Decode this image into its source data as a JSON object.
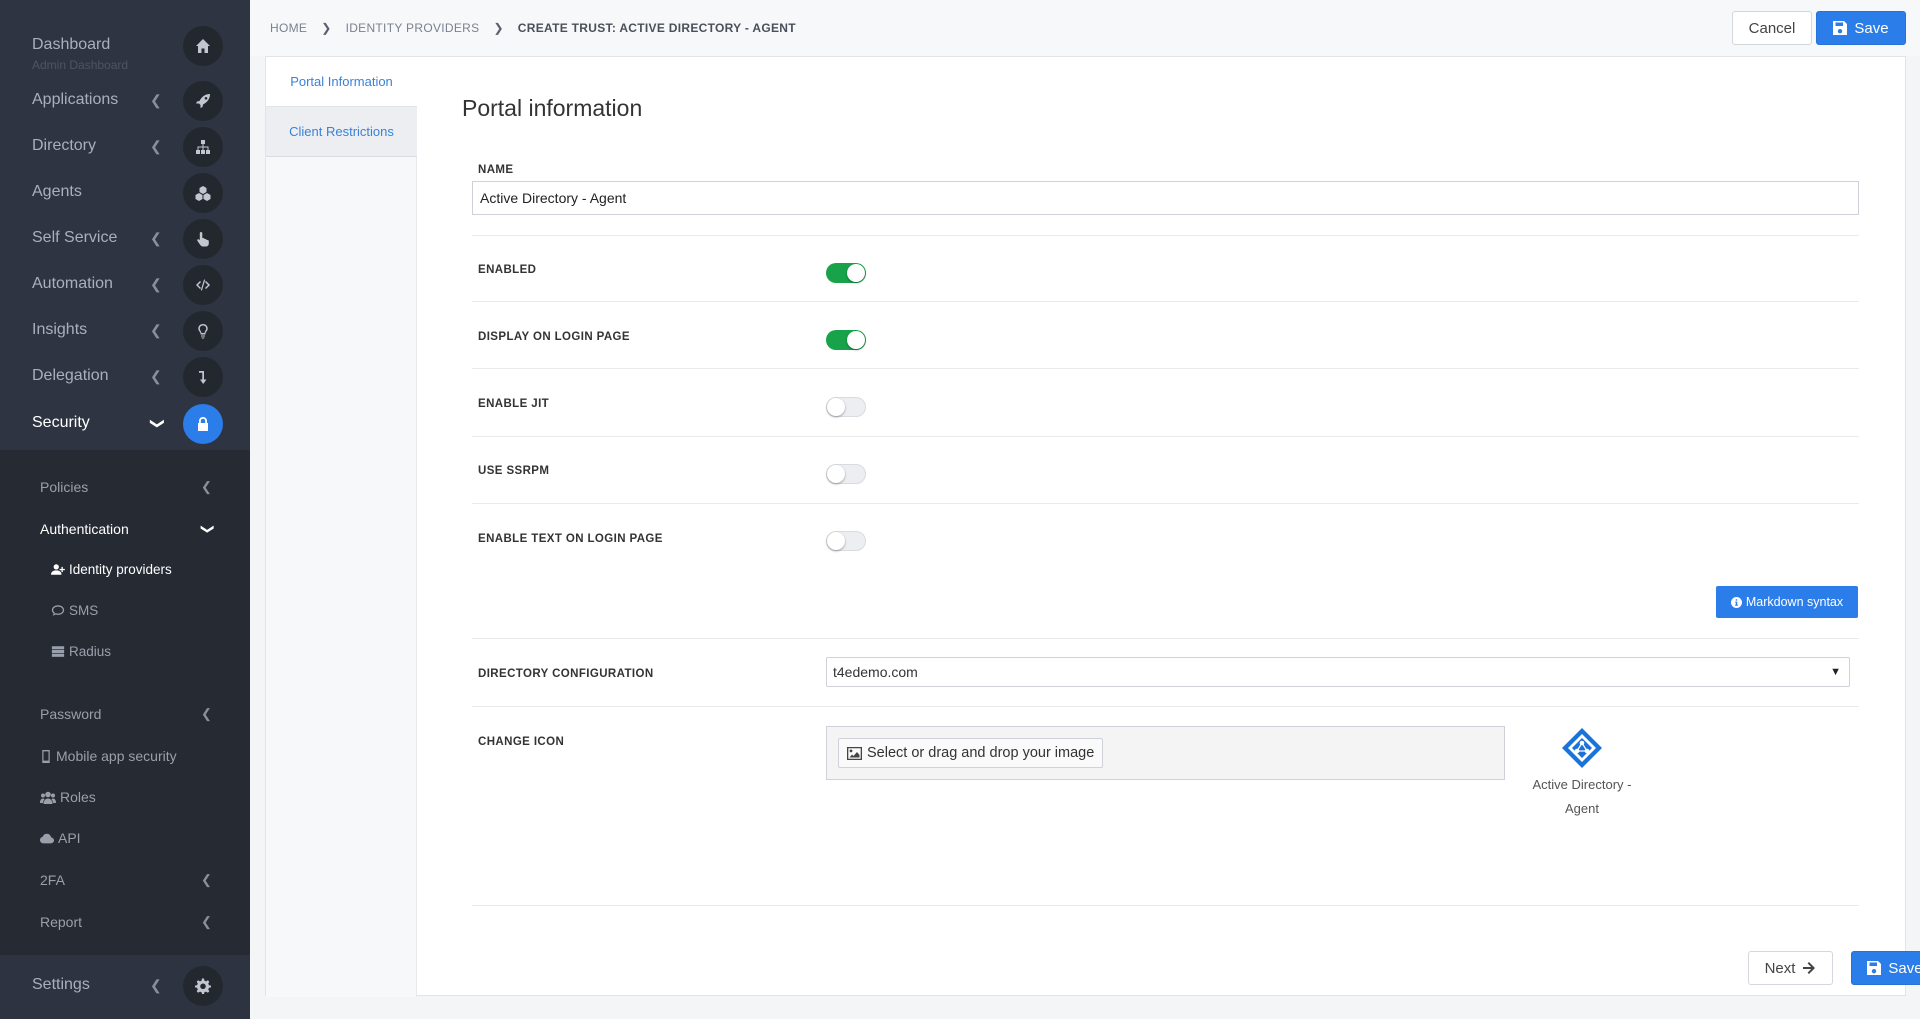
{
  "sidebar": {
    "dashboard": {
      "label": "Dashboard",
      "sub": "Admin Dashboard",
      "icon": "home-icon"
    },
    "applications": {
      "label": "Applications",
      "icon": "rocket-icon"
    },
    "directory": {
      "label": "Directory",
      "icon": "sitemap-icon"
    },
    "agents": {
      "label": "Agents",
      "icon": "cubes-icon"
    },
    "self_service": {
      "label": "Self Service",
      "icon": "hand-pointer-icon"
    },
    "automation": {
      "label": "Automation",
      "icon": "code-icon"
    },
    "insights": {
      "label": "Insights",
      "icon": "lightbulb-icon"
    },
    "delegation": {
      "label": "Delegation",
      "icon": "level-down-icon"
    },
    "security": {
      "label": "Security",
      "icon": "lock-icon"
    },
    "security_sub": {
      "policies": "Policies",
      "authentication": "Authentication",
      "identity_providers": "Identity providers",
      "sms": "SMS",
      "radius": "Radius",
      "password": "Password",
      "mobile_app_security": "Mobile app security",
      "roles": "Roles",
      "api": "API",
      "twofa": "2FA",
      "report": "Report"
    },
    "settings": {
      "label": "Settings",
      "icon": "gear-icon"
    }
  },
  "breadcrumb": {
    "home": "HOME",
    "identity_providers": "IDENTITY PROVIDERS",
    "current": "CREATE TRUST: ACTIVE DIRECTORY - AGENT"
  },
  "toolbar": {
    "cancel_label": "Cancel",
    "save_label": "Save"
  },
  "tabs": {
    "portal_information": "Portal Information",
    "client_restrictions": "Client Restrictions"
  },
  "form": {
    "title": "Portal information",
    "name_label": "NAME",
    "name_value": "Active Directory - Agent",
    "enabled_label": "ENABLED",
    "enabled": true,
    "display_login_label": "DISPLAY ON LOGIN PAGE",
    "display_login": true,
    "enable_jit_label": "ENABLE JIT",
    "enable_jit": false,
    "use_ssrpm_label": "USE SSRPM",
    "use_ssrpm": false,
    "enable_text_label": "ENABLE TEXT ON LOGIN PAGE",
    "enable_text": false,
    "markdown_button": "Markdown syntax",
    "directory_config_label": "DIRECTORY CONFIGURATION",
    "directory_config_value": "t4edemo.com",
    "change_icon_label": "CHANGE ICON",
    "dropzone_button": "Select or drag and drop your image",
    "preview_line1": "Active Directory -",
    "preview_line2": "Agent"
  },
  "footer": {
    "save_label": "Save",
    "next_label": "Next"
  },
  "colors": {
    "accent": "#2b7de9",
    "toggle_on": "#18a24a",
    "sidebar_bg": "#2d3340"
  }
}
